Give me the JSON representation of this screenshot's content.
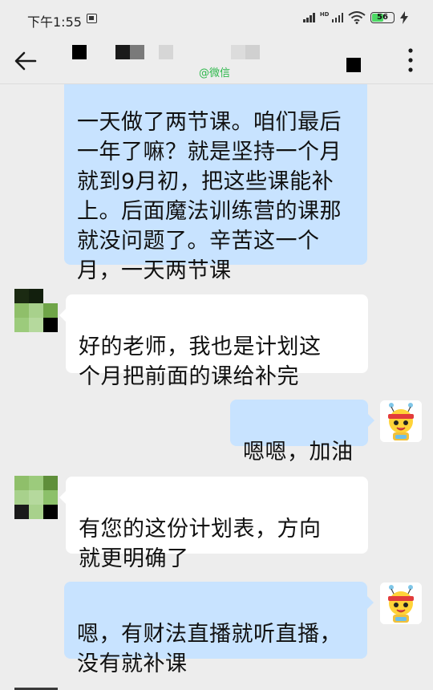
{
  "status_bar": {
    "time": "下午1:55",
    "network": "HD",
    "battery": "56",
    "battery_level": 0.56,
    "battery_color": "#4cd964"
  },
  "header": {
    "back_icon": "arrow-left-icon",
    "watermark": "@微信",
    "more_icon": "more-vertical-icon"
  },
  "colors": {
    "my_bubble": "#c8e3ff",
    "their_bubble": "#ffffff",
    "background": "#ededed",
    "watermark": "#2db84b"
  },
  "messages": [
    {
      "from": "me",
      "text": "一天做了两节课。咱们最后\n一年了嘛？就是坚持一个月\n就到9月初，把这些课能补\n上。后面魔法训练营的课那\n就没问题了。辛苦这一个\n月，一天两节课"
    },
    {
      "from": "them",
      "text": "好的老师，我也是计划这\n个月把前面的课给补完"
    },
    {
      "from": "me",
      "text": "嗯嗯，加油"
    },
    {
      "from": "them",
      "text": "有您的这份计划表，方向\n就更明确了"
    },
    {
      "from": "me",
      "text": "嗯，有财法直播就听直播，\n没有就补课"
    }
  ]
}
